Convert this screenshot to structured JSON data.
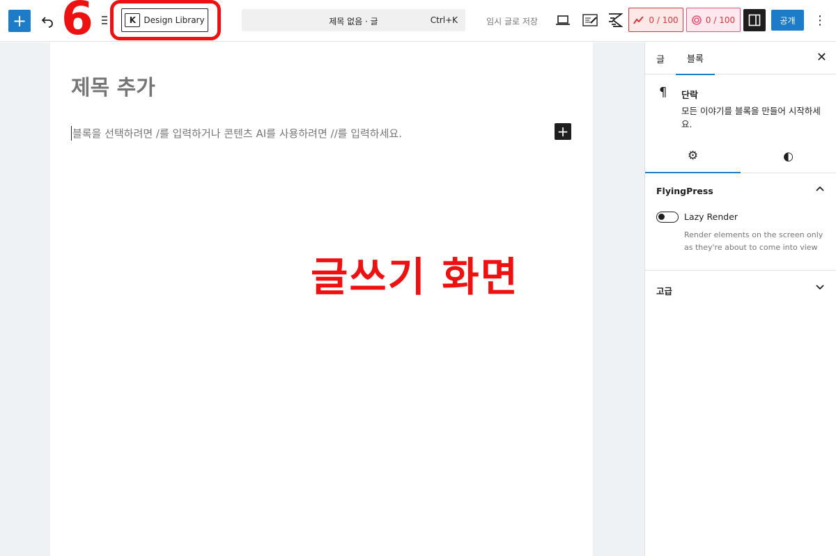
{
  "toolbar": {
    "add_glyph": "+",
    "design_library_label": "Design Library",
    "design_library_icon_letter": "K",
    "document_title": "제목 없음 · 글",
    "shortcut": "Ctrl+K",
    "save_draft_label": "임시 글로 저장",
    "seo_score_1": "0 / 100",
    "seo_score_2": "0 / 100",
    "publish_label": "공개",
    "more_glyph": "⋮"
  },
  "annotation": {
    "step_number": "6",
    "overlay_text": "글쓰기 화면"
  },
  "editor": {
    "title_placeholder": "제목 추가",
    "paragraph_placeholder": "블록을 선택하려면 /를 입력하거나 콘텐츠 AI를 사용하려면 //를 입력하세요.",
    "inline_add_glyph": "+"
  },
  "sidebar": {
    "tab_post": "글",
    "tab_block": "블록",
    "close_glyph": "✕",
    "block_name": "단락",
    "block_description": "모든 이야기를 블록을 만들어 시작하세요.",
    "flyingpress": {
      "title": "FlyingPress",
      "lazy_render_label": "Lazy Render",
      "lazy_render_on": false,
      "lazy_render_help": "Render elements on the screen only as they're about to come into view"
    },
    "advanced_title": "고급"
  },
  "colors": {
    "accent": "#1d7cc7",
    "annotation_red": "#ee1111",
    "canvas_bg": "#eef2f4"
  }
}
